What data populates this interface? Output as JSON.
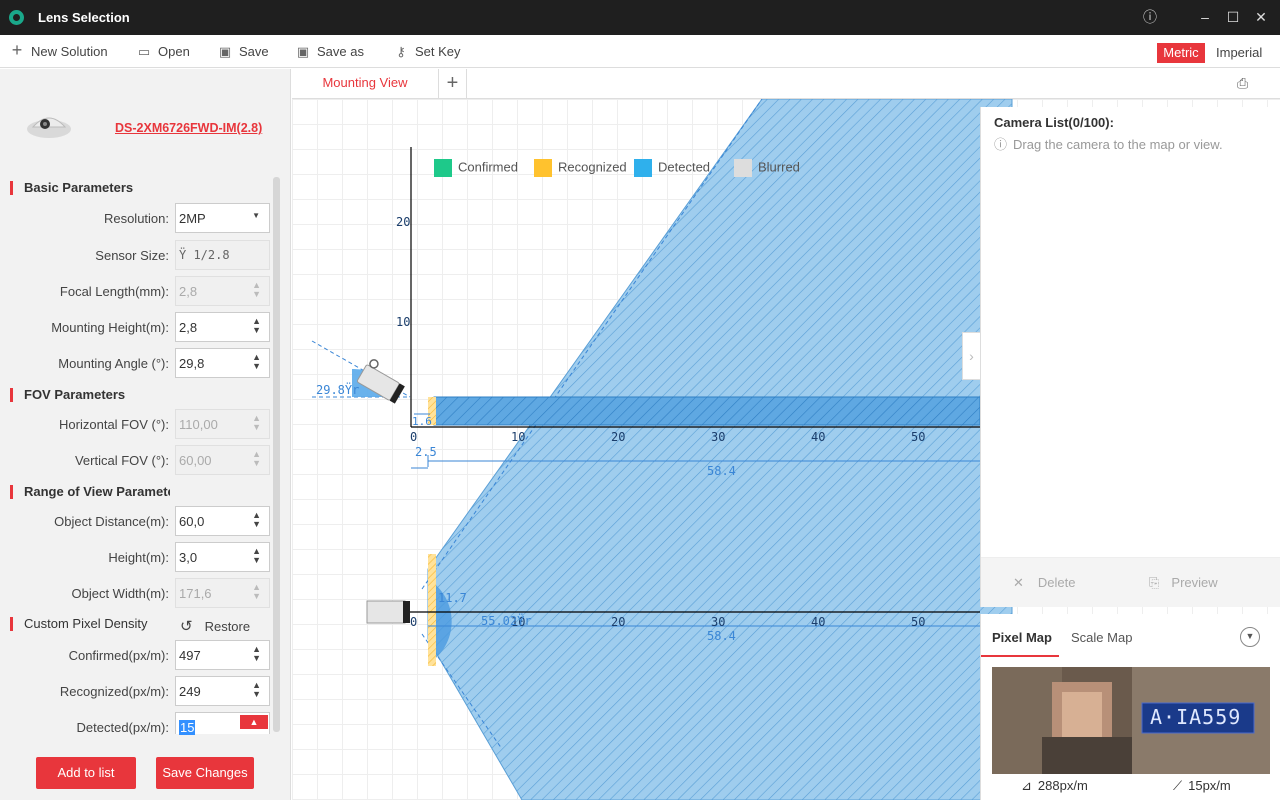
{
  "app": {
    "title": "Lens Selection"
  },
  "toolbar": {
    "new_solution": "New Solution",
    "open": "Open",
    "save": "Save",
    "save_as": "Save as",
    "set_key": "Set Key",
    "metric": "Metric",
    "imperial": "Imperial"
  },
  "camera": {
    "model": "DS-2XM6726FWD-IM(2.8)"
  },
  "basic": {
    "title": "Basic Parameters",
    "resolution_label": "Resolution:",
    "resolution": "2MP",
    "sensor_label": "Sensor Size:",
    "sensor": "Ÿ 1/2.8",
    "focal_label": "Focal Length(mm):",
    "focal": "2,8",
    "mheight_label": "Mounting Height(m):",
    "mheight": "2,8",
    "mangle_label": "Mounting Angle (°):",
    "mangle": "29,8"
  },
  "fov": {
    "title": "FOV Parameters",
    "hfov_label": "Horizontal FOV (°):",
    "hfov": "110,00",
    "vfov_label": "Vertical FOV (°):",
    "vfov": "60,00"
  },
  "range": {
    "title": "Range of View Parameters",
    "dist_label": "Object Distance(m):",
    "dist": "60,0",
    "height_label": "Height(m):",
    "height": "3,0",
    "width_label": "Object Width(m):",
    "width": "171,6"
  },
  "density": {
    "title": "Custom Pixel Density",
    "restore": "Restore",
    "confirmed_label": "Confirmed(px/m):",
    "confirmed": "497",
    "recognized_label": "Recognized(px/m):",
    "recognized": "249",
    "detected_label": "Detected(px/m):",
    "detected": "15"
  },
  "buttons": {
    "add": "Add to list",
    "save": "Save Changes"
  },
  "tabs": {
    "mounting": "Mounting View"
  },
  "legend": {
    "confirmed": "Confirmed",
    "recognized": "Recognized",
    "detected": "Detected",
    "blurred": "Blurred"
  },
  "colors": {
    "confirmed": "#1ec98a",
    "recognized": "#ffc22e",
    "detected": "#2fb0ec",
    "blurred": "#dddddd",
    "accent": "#e8363c"
  },
  "side_view": {
    "y_ticks": [
      "20",
      "10"
    ],
    "x_ticks": [
      "0",
      "10",
      "20",
      "30",
      "40",
      "50"
    ],
    "angle": "29.8Ÿr",
    "d_near": "1.6",
    "d_start": "2.5",
    "d_total": "58.4"
  },
  "top_view": {
    "x_ticks": [
      "0",
      "10",
      "20",
      "30",
      "40",
      "50"
    ],
    "width": "11.7",
    "angle": "55.02Ÿr",
    "d_total": "58.4"
  },
  "camera_list": {
    "title": "Camera List(0/100):",
    "hint": "Drag the camera to the map or view.",
    "delete": "Delete",
    "preview": "Preview"
  },
  "pixel_map": {
    "tab_pixel": "Pixel Map",
    "tab_scale": "Scale Map",
    "plate": "A·IA559",
    "val_left": "288px/m",
    "val_right": "15px/m"
  }
}
